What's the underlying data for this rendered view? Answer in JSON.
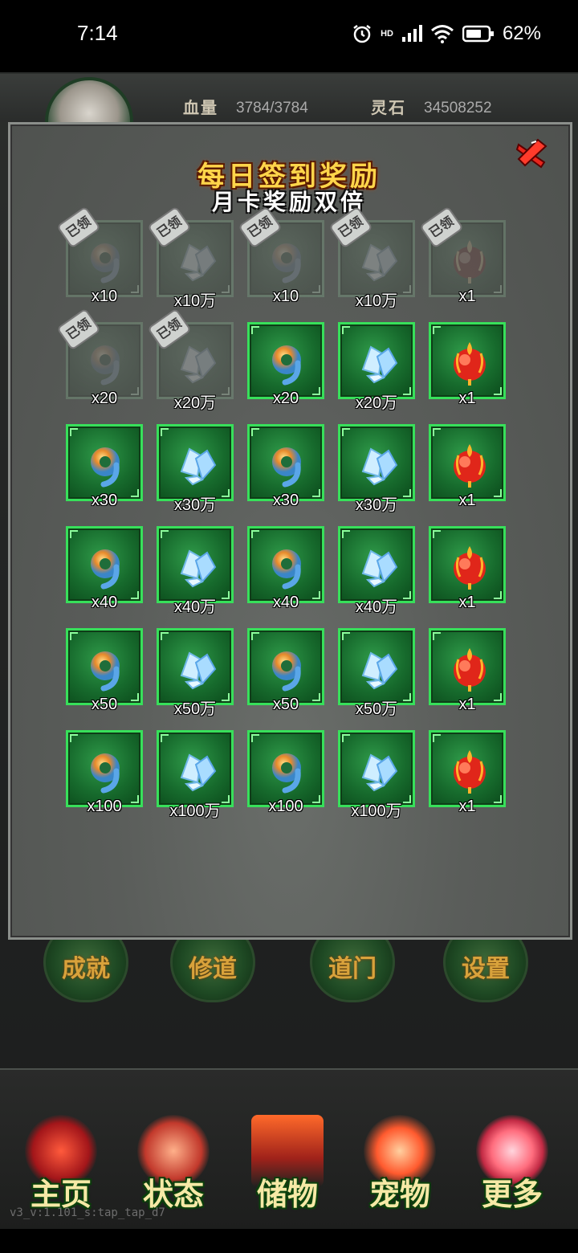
{
  "status_bar": {
    "time": "7:14",
    "network": "HD",
    "battery_percent": "62%"
  },
  "player": {
    "hp_label": "血量",
    "hp_value": "3784/3784",
    "stone_label": "灵石",
    "stone_value": "34508252"
  },
  "modal": {
    "title": "每日签到奖励",
    "subtitle": "月卡奖励双倍",
    "claimed_stamp": "已领",
    "rewards": [
      {
        "item": "orb",
        "qty": "x10",
        "claimed": true
      },
      {
        "item": "crystal",
        "qty": "x10万",
        "claimed": true
      },
      {
        "item": "orb",
        "qty": "x10",
        "claimed": true
      },
      {
        "item": "crystal",
        "qty": "x10万",
        "claimed": true
      },
      {
        "item": "fire-seal",
        "qty": "x1",
        "claimed": true
      },
      {
        "item": "orb",
        "qty": "x20",
        "claimed": true
      },
      {
        "item": "crystal",
        "qty": "x20万",
        "claimed": true
      },
      {
        "item": "orb",
        "qty": "x20",
        "claimed": false
      },
      {
        "item": "crystal",
        "qty": "x20万",
        "claimed": false
      },
      {
        "item": "fire-seal",
        "qty": "x1",
        "claimed": false
      },
      {
        "item": "orb",
        "qty": "x30",
        "claimed": false
      },
      {
        "item": "crystal",
        "qty": "x30万",
        "claimed": false
      },
      {
        "item": "orb",
        "qty": "x30",
        "claimed": false
      },
      {
        "item": "crystal",
        "qty": "x30万",
        "claimed": false
      },
      {
        "item": "fire-seal",
        "qty": "x1",
        "claimed": false
      },
      {
        "item": "orb",
        "qty": "x40",
        "claimed": false
      },
      {
        "item": "crystal",
        "qty": "x40万",
        "claimed": false
      },
      {
        "item": "orb",
        "qty": "x40",
        "claimed": false
      },
      {
        "item": "crystal",
        "qty": "x40万",
        "claimed": false
      },
      {
        "item": "fire-seal",
        "qty": "x1",
        "claimed": false
      },
      {
        "item": "orb",
        "qty": "x50",
        "claimed": false
      },
      {
        "item": "crystal",
        "qty": "x50万",
        "claimed": false
      },
      {
        "item": "orb",
        "qty": "x50",
        "claimed": false
      },
      {
        "item": "crystal",
        "qty": "x50万",
        "claimed": false
      },
      {
        "item": "fire-seal",
        "qty": "x1",
        "claimed": false
      },
      {
        "item": "orb",
        "qty": "x100",
        "claimed": false
      },
      {
        "item": "crystal",
        "qty": "x100万",
        "claimed": false
      },
      {
        "item": "orb",
        "qty": "x100",
        "claimed": false
      },
      {
        "item": "crystal",
        "qty": "x100万",
        "claimed": false
      },
      {
        "item": "fire-seal",
        "qty": "x1",
        "claimed": false
      }
    ]
  },
  "round_buttons": [
    "成就",
    "修道",
    "道门",
    "设置"
  ],
  "bottom_nav": [
    "主页",
    "状态",
    "储物",
    "宠物",
    "更多"
  ],
  "build_tag": "v3_v:1.101_s:tap_tap_d7",
  "colors": {
    "tile_green": "#176b2d",
    "tile_border": "#37e05a",
    "title_gold": "#ffd54a",
    "modal_gray": "#5a5d5a"
  }
}
